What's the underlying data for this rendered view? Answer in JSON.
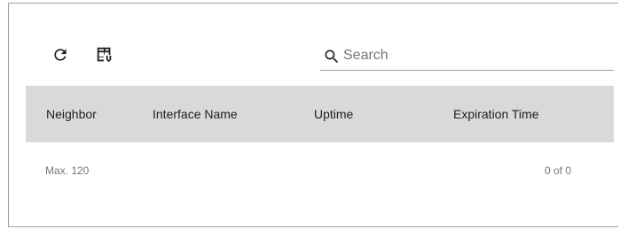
{
  "toolbar": {
    "refresh_icon": "refresh-icon",
    "columns_icon": "table-columns-download-icon"
  },
  "search": {
    "placeholder": "Search",
    "value": "",
    "icon": "search-icon"
  },
  "table": {
    "columns": [
      "Neighbor",
      "Interface Name",
      "Uptime",
      "Expiration Time"
    ],
    "header_bg": "#d9d9d9",
    "rows": []
  },
  "footer": {
    "max_label": "Max. 120",
    "page_count": "0 of 0"
  }
}
